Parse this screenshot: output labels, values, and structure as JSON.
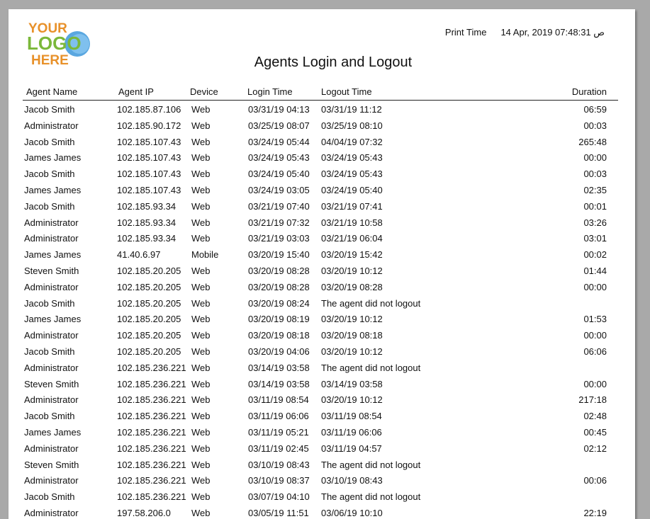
{
  "logo": {
    "line1": "YOUR",
    "line2": "LOGO",
    "line3": "HERE"
  },
  "print_time": {
    "label": "Print Time",
    "value": "14 Apr, 2019 07:48:31 ص"
  },
  "title": "Agents Login and Logout",
  "columns": [
    "Agent Name",
    "Agent IP",
    "Device",
    "Login Time",
    "Logout Time",
    "Duration"
  ],
  "rows": [
    [
      "Jacob Smith",
      "102.185.87.106",
      "Web",
      "03/31/19 04:13",
      "03/31/19 11:12",
      "06:59"
    ],
    [
      "Administrator",
      "102.185.90.172",
      "Web",
      "03/25/19 08:07",
      "03/25/19 08:10",
      "00:03"
    ],
    [
      "Jacob Smith",
      "102.185.107.43",
      "Web",
      "03/24/19 05:44",
      "04/04/19 07:32",
      "265:48"
    ],
    [
      "James James",
      "102.185.107.43",
      "Web",
      "03/24/19 05:43",
      "03/24/19 05:43",
      "00:00"
    ],
    [
      "Jacob Smith",
      "102.185.107.43",
      "Web",
      "03/24/19 05:40",
      "03/24/19 05:43",
      "00:03"
    ],
    [
      "James James",
      "102.185.107.43",
      "Web",
      "03/24/19 03:05",
      "03/24/19 05:40",
      "02:35"
    ],
    [
      "Jacob Smith",
      "102.185.93.34",
      "Web",
      "03/21/19 07:40",
      "03/21/19 07:41",
      "00:01"
    ],
    [
      "Administrator",
      "102.185.93.34",
      "Web",
      "03/21/19 07:32",
      "03/21/19 10:58",
      "03:26"
    ],
    [
      "Administrator",
      "102.185.93.34",
      "Web",
      "03/21/19 03:03",
      "03/21/19 06:04",
      "03:01"
    ],
    [
      "James James",
      "41.40.6.97",
      "Mobile",
      "03/20/19 15:40",
      "03/20/19 15:42",
      "00:02"
    ],
    [
      "Steven Smith",
      "102.185.20.205",
      "Web",
      "03/20/19 08:28",
      "03/20/19 10:12",
      "01:44"
    ],
    [
      "Administrator",
      "102.185.20.205",
      "Web",
      "03/20/19 08:28",
      "03/20/19 08:28",
      "00:00"
    ],
    [
      "Jacob Smith",
      "102.185.20.205",
      "Web",
      "03/20/19 08:24",
      "The agent did not logout",
      ""
    ],
    [
      "James James",
      "102.185.20.205",
      "Web",
      "03/20/19 08:19",
      "03/20/19 10:12",
      "01:53"
    ],
    [
      "Administrator",
      "102.185.20.205",
      "Web",
      "03/20/19 08:18",
      "03/20/19 08:18",
      "00:00"
    ],
    [
      "Jacob Smith",
      "102.185.20.205",
      "Web",
      "03/20/19 04:06",
      "03/20/19 10:12",
      "06:06"
    ],
    [
      "Administrator",
      "102.185.236.221",
      "Web",
      "03/14/19 03:58",
      "The agent did not logout",
      ""
    ],
    [
      "Steven Smith",
      "102.185.236.221",
      "Web",
      "03/14/19 03:58",
      "03/14/19 03:58",
      "00:00"
    ],
    [
      "Administrator",
      "102.185.236.221",
      "Web",
      "03/11/19 08:54",
      "03/20/19 10:12",
      "217:18"
    ],
    [
      "Jacob Smith",
      "102.185.236.221",
      "Web",
      "03/11/19 06:06",
      "03/11/19 08:54",
      "02:48"
    ],
    [
      "James James",
      "102.185.236.221",
      "Web",
      "03/11/19 05:21",
      "03/11/19 06:06",
      "00:45"
    ],
    [
      "Administrator",
      "102.185.236.221",
      "Web",
      "03/11/19 02:45",
      "03/11/19 04:57",
      "02:12"
    ],
    [
      "Steven Smith",
      "102.185.236.221",
      "Web",
      "03/10/19 08:43",
      "The agent did not logout",
      ""
    ],
    [
      "Administrator",
      "102.185.236.221",
      "Web",
      "03/10/19 08:37",
      "03/10/19 08:43",
      "00:06"
    ],
    [
      "Jacob Smith",
      "102.185.236.221",
      "Web",
      "03/07/19 04:10",
      "The agent did not logout",
      ""
    ],
    [
      "Administrator",
      "197.58.206.0",
      "Web",
      "03/05/19 11:51",
      "03/06/19 10:10",
      "22:19"
    ]
  ]
}
